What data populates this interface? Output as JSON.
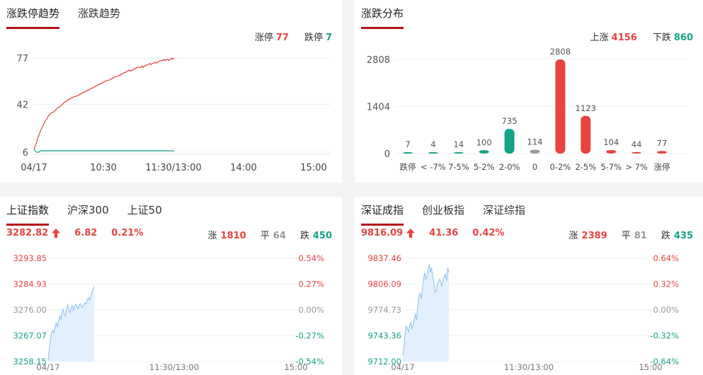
{
  "panel_limit": {
    "tabs": [
      "涨跌停趋势",
      "涨跌趋势"
    ],
    "counts": {
      "up_label": "涨停",
      "up_value": "77",
      "down_label": "跌停",
      "down_value": "7"
    }
  },
  "panel_dist": {
    "tabs": [
      "涨跌分布"
    ],
    "counts": {
      "up_label": "上涨",
      "up_value": "4156",
      "down_label": "下跌",
      "down_value": "860"
    }
  },
  "panel_sh": {
    "tabs": [
      "上证指数",
      "沪深300",
      "上证50"
    ],
    "quote": {
      "price": "3282.82",
      "change": "6.82",
      "pct": "0.21%",
      "up_label": "涨",
      "up_value": "1810",
      "flat_label": "平",
      "flat_value": "64",
      "down_label": "跌",
      "down_value": "450"
    }
  },
  "panel_sz": {
    "tabs": [
      "深证成指",
      "创业板指",
      "深证综指"
    ],
    "quote": {
      "price": "9816.09",
      "change": "41.36",
      "pct": "0.42%",
      "up_label": "涨",
      "up_value": "2389",
      "flat_label": "平",
      "flat_value": "81",
      "down_label": "跌",
      "down_value": "435"
    }
  },
  "colors": {
    "red": "#e8433f",
    "green": "#13a385",
    "grey": "#999999",
    "area": "#e3f0ff",
    "line": "#8cc0f2",
    "accent": "#b5121b"
  },
  "chart_data": [
    {
      "id": "limit_trend",
      "type": "line",
      "yticks": [
        "77",
        "42",
        "6"
      ],
      "ylim": [
        6,
        77
      ],
      "xticks": [
        "04/17",
        "10:30",
        "11:30/13:00",
        "14:00",
        "15:00"
      ],
      "series": [
        {
          "color": "#e8433f",
          "values": [
            8,
            11,
            13,
            17,
            19,
            22,
            24,
            26,
            28,
            30,
            31,
            33,
            34,
            35,
            36,
            36,
            37,
            38,
            39,
            40,
            40,
            41,
            42,
            43,
            44,
            44,
            45,
            46,
            46,
            47,
            47,
            48,
            48,
            48,
            49,
            49,
            50,
            50,
            51,
            51,
            52,
            52,
            53,
            53,
            54,
            54,
            55,
            55,
            56,
            56,
            57,
            57,
            58,
            58,
            59,
            59,
            60,
            60,
            60,
            61,
            61,
            62,
            62,
            63,
            63,
            63,
            64,
            64,
            65,
            65,
            66,
            66,
            67,
            67,
            68,
            67,
            68,
            68,
            69,
            69,
            70,
            70,
            70,
            70,
            71,
            70,
            71,
            71,
            72,
            72,
            73,
            72,
            73,
            73,
            74,
            73,
            74,
            74,
            75,
            75,
            75,
            76,
            75,
            76,
            76,
            75,
            76,
            77,
            76,
            77
          ]
        },
        {
          "color": "#13a385",
          "values": [
            8,
            7,
            6,
            6,
            6,
            7,
            7,
            7,
            7,
            7,
            7,
            7,
            7,
            7,
            7,
            7,
            7,
            7,
            7,
            7,
            7,
            7,
            7,
            7,
            7,
            7,
            7,
            7,
            7,
            7,
            7,
            7,
            7,
            7,
            7,
            7,
            7,
            7,
            7,
            7,
            7,
            7,
            7,
            7,
            7,
            7,
            7,
            7,
            7,
            7,
            7,
            7,
            7,
            7,
            7,
            7,
            7,
            7,
            7,
            7,
            7,
            7,
            7,
            7,
            7,
            7,
            7,
            7,
            7,
            7,
            7,
            7,
            7,
            7,
            7,
            7,
            7,
            7,
            7,
            7,
            7,
            7,
            7,
            7,
            7,
            7,
            7,
            7,
            7,
            7,
            7,
            7,
            7,
            7,
            7,
            7,
            7,
            7,
            7,
            7,
            7,
            7,
            7,
            7,
            7,
            7,
            7,
            7,
            7,
            7
          ]
        }
      ]
    },
    {
      "id": "distribution",
      "type": "bar",
      "yticks": [
        "2808",
        "1404",
        "0"
      ],
      "ylim": [
        0,
        2808
      ],
      "categories": [
        "跌停",
        "< -7%",
        "7-5%",
        "5-2%",
        "2-0%",
        "0",
        "0-2%",
        "2-5%",
        "5-7%",
        "> 7%",
        "涨停"
      ],
      "values": [
        7,
        4,
        14,
        100,
        735,
        114,
        2808,
        1123,
        104,
        44,
        77
      ],
      "colors": [
        "#13a385",
        "#13a385",
        "#13a385",
        "#13a385",
        "#13a385",
        "#999999",
        "#e8433f",
        "#e8433f",
        "#e8433f",
        "#e8433f",
        "#e8433f"
      ]
    },
    {
      "id": "sh_index",
      "type": "area",
      "yticks_left": [
        "3293.85",
        "3284.93",
        "3276.00",
        "3267.07",
        "3258.15"
      ],
      "yticks_right": [
        "0.54%",
        "0.27%",
        "0.00%",
        "-0.27%",
        "-0.54%"
      ],
      "ylim": [
        3258.15,
        3293.85
      ],
      "xticks": [
        "04/17",
        "11:30/13:00",
        "15:00"
      ],
      "values": [
        3258.6,
        3262.5,
        3266.0,
        3268.2,
        3269.0,
        3268.0,
        3270.1,
        3271.5,
        3270.3,
        3272.0,
        3273.8,
        3272.5,
        3275.2,
        3276.3,
        3274.6,
        3273.9,
        3276.5,
        3277.8,
        3276.2,
        3275.0,
        3276.8,
        3277.5,
        3276.0,
        3277.2,
        3278.0,
        3277.1,
        3276.4,
        3277.6,
        3278.2,
        3277.4,
        3276.9,
        3277.9,
        3278.5,
        3278.1,
        3279.6,
        3280.2,
        3279.4,
        3280.8,
        3281.9,
        3283.1,
        3284.0
      ]
    },
    {
      "id": "sz_index",
      "type": "area",
      "yticks_left": [
        "9837.46",
        "9806.09",
        "9774.73",
        "9743.36",
        "9712.00"
      ],
      "yticks_right": [
        "0.64%",
        "0.32%",
        "0.00%",
        "-0.32%",
        "-0.64%"
      ],
      "ylim": [
        9712.0,
        9837.46
      ],
      "xticks": [
        "04/17",
        "11:30/13:00",
        "15:00"
      ],
      "values": [
        9720,
        9730,
        9745,
        9755,
        9752,
        9748,
        9756,
        9760,
        9752,
        9755,
        9765,
        9770,
        9762,
        9780,
        9792,
        9795,
        9788,
        9800,
        9812,
        9820,
        9812,
        9815,
        9824,
        9830,
        9820,
        9826,
        9815,
        9808,
        9796,
        9798,
        9806,
        9810,
        9812,
        9808,
        9804,
        9812,
        9816,
        9818,
        9810,
        9826,
        9820
      ]
    }
  ]
}
